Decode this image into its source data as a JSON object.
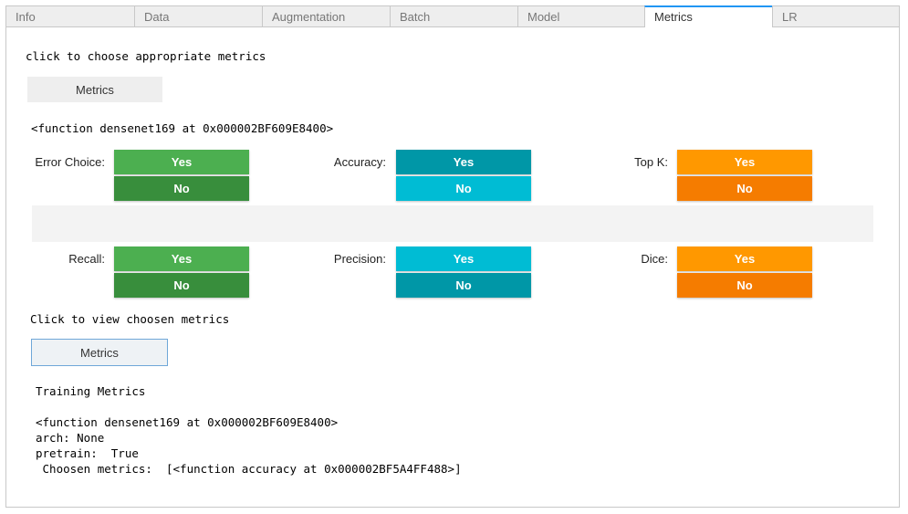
{
  "tabs": [
    "Info",
    "Data",
    "Augmentation",
    "Batch",
    "Model",
    "Metrics",
    "LR"
  ],
  "active_tab": "Metrics",
  "instruction_text": "click to choose appropriate metrics",
  "choose_metrics_button": "Metrics",
  "function_text": "<function densenet169 at 0x000002BF609E8400>",
  "toggles": [
    {
      "label": "Error Choice:",
      "yes": "Yes",
      "no": "No",
      "selected": "No"
    },
    {
      "label": "Accuracy:",
      "yes": "Yes",
      "no": "No",
      "selected": "Yes"
    },
    {
      "label": "Top K:",
      "yes": "Yes",
      "no": "No",
      "selected": "No"
    },
    {
      "label": "Recall:",
      "yes": "Yes",
      "no": "No",
      "selected": "No"
    },
    {
      "label": "Precision:",
      "yes": "Yes",
      "no": "No",
      "selected": "No"
    },
    {
      "label": "Dice:",
      "yes": "Yes",
      "no": "No",
      "selected": "No"
    }
  ],
  "colors": {
    "green_light": "#4caf50",
    "green_dark": "#388e3c",
    "cyan_light": "#00bcd4",
    "cyan_dark": "#0097a7",
    "orange_light": "#ff9800",
    "orange_dark": "#f57c00"
  },
  "view_text": "Click to view choosen metrics",
  "view_metrics_button": "Metrics",
  "output": {
    "heading": "Training Metrics",
    "function_line": "<function densenet169 at 0x000002BF609E8400>",
    "arch_line": "arch: None",
    "pretrain_line": "pretrain:  True",
    "chosen_line": " Choosen metrics:  [<function accuracy at 0x000002BF5A4FF488>]"
  }
}
